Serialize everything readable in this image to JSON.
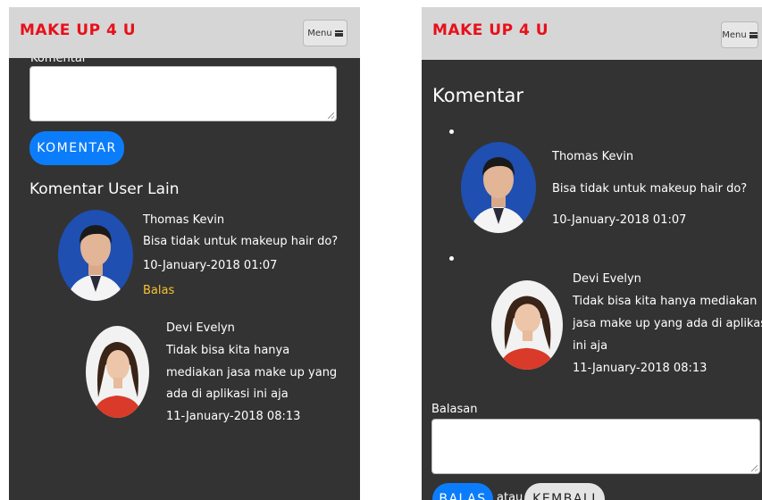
{
  "app": {
    "brand": "MAKE UP 4 U",
    "menu_label": "Menu"
  },
  "left": {
    "comment_field_label": "Komentar",
    "comment_button": "KOMENTAR",
    "section_title": "Komentar User Lain",
    "comments": [
      {
        "name": "Thomas Kevin",
        "lines": [
          "Bisa tidak untuk makeup hair do?"
        ],
        "date": "10-January-2018 01:07",
        "reply_link": "Balas"
      },
      {
        "name": "Devi Evelyn",
        "lines": [
          "Tidak bisa kita hanya",
          "mediakan jasa make up yang",
          "ada di aplikasi ini aja"
        ],
        "date": "11-January-2018 08:13"
      }
    ]
  },
  "right": {
    "title": "Komentar",
    "comments": [
      {
        "name": "Thomas Kevin",
        "lines": [
          "Bisa tidak untuk makeup hair do?"
        ],
        "date": "10-January-2018 01:07"
      },
      {
        "name": "Devi Evelyn",
        "lines": [
          "Tidak bisa kita hanya mediakan",
          "jasa make up yang ada di aplikasi",
          "ini aja"
        ],
        "date": "11-January-2018 08:13"
      }
    ],
    "reply_label": "Balasan",
    "reply_button": "BALAS",
    "or_text": "atau",
    "back_button": "KEMBALI"
  },
  "colors": {
    "brand": "#e8101a",
    "accent_blue": "#0b7dfb",
    "link_yellow": "#f5c431",
    "background": "#333333",
    "navbar": "#d6d6d6"
  }
}
